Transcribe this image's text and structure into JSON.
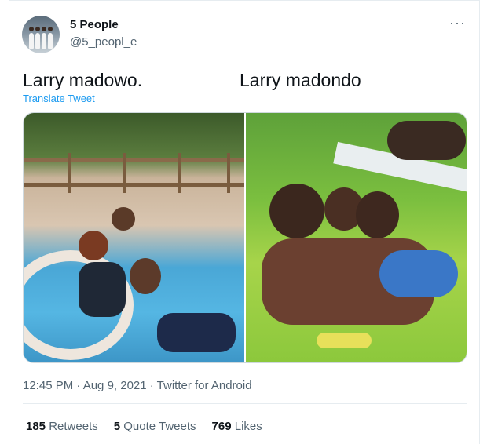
{
  "author": {
    "name": "5 People",
    "handle": "@5_peopl_e"
  },
  "menu": {
    "more_icon": "more-horizontal-icon",
    "more_glyph": "···"
  },
  "tweet": {
    "text_left": "Larry madowo.",
    "text_right": "Larry madondo",
    "translate_label": "Translate Tweet"
  },
  "meta": {
    "timestamp": "12:45 PM · Aug 9, 2021 · Twitter for Android"
  },
  "stats": {
    "retweets_count": "185",
    "retweets_label": "Retweets",
    "quotes_count": "5",
    "quotes_label": "Quote Tweets",
    "likes_count": "769",
    "likes_label": "Likes"
  },
  "colors": {
    "link": "#1d9bf0",
    "secondary_text": "#536471",
    "primary_text": "#0f1419",
    "border": "#e6ecf0"
  }
}
